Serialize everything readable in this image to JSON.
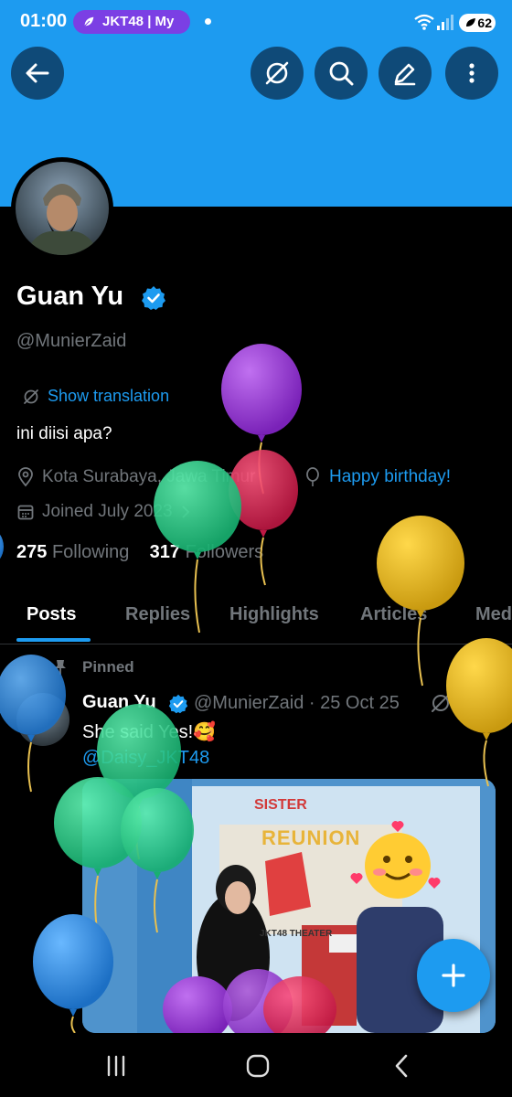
{
  "status_bar": {
    "time": "01:00",
    "app_pill": "JKT48 | My",
    "battery": "62"
  },
  "toolbar": {
    "back_icon": "arrow-left-icon",
    "buttons": [
      "grok-icon",
      "search-icon",
      "edit-icon",
      "more-icon"
    ]
  },
  "profile": {
    "name": "Guan Yu",
    "handle": "@MunierZaid",
    "translation_label": "Show translation",
    "bio": "ini diisi apa?",
    "location": "Kota Surabaya, Jawa Timur",
    "birthday_link": "Happy birthday!",
    "joined": "Joined July 2023",
    "following_count": "275",
    "following_label": "Following",
    "followers_count": "317",
    "followers_label": "Followers"
  },
  "tabs": [
    "Posts",
    "Replies",
    "Highlights",
    "Articles",
    "Media"
  ],
  "active_tab": "Posts",
  "post": {
    "pinned_label": "Pinned",
    "author": "Guan Yu",
    "handle_date": "@MunierZaid · 25 Oct 25",
    "text": "She said Yes!🥰",
    "mention": "@Daisy_JKT48",
    "image_sign_1": "SISTER",
    "image_sign_2": "REUNION",
    "image_sign_3": "JKT48 THEATER"
  },
  "colors": {
    "accent": "#1d9bf0",
    "background": "#000000",
    "muted": "#71767b",
    "pill": "#7b3fe4"
  }
}
